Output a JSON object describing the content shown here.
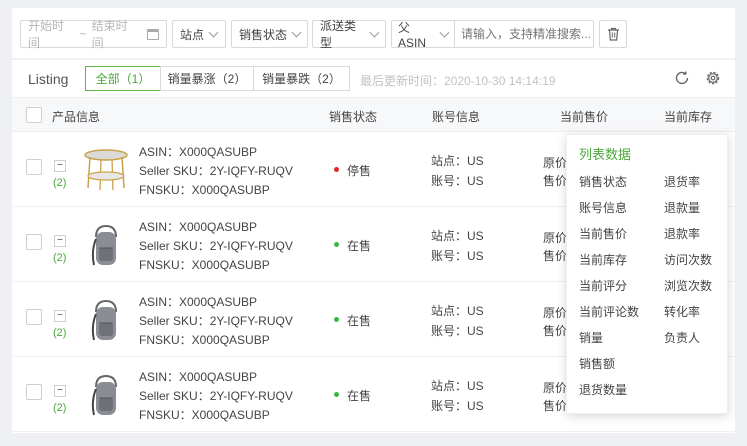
{
  "filters": {
    "start_placeholder": "开始时间",
    "range_sep": "~",
    "end_placeholder": "结束时间",
    "site_label": "站点",
    "sale_status_label": "销售状态",
    "ship_type_label": "派送类型",
    "asin_type_label": "父ASIN",
    "search_placeholder": "请输入，支持精准搜索..."
  },
  "toolbar": {
    "title": "Listing",
    "tabs": [
      {
        "label": "全部（1）"
      },
      {
        "label": "销量暴涨（2）"
      },
      {
        "label": "销量暴跌（2）"
      }
    ],
    "updated": "最后更新时间：2020-10-30 14:14:19",
    "icons": [
      "refresh-icon",
      "gear-icon"
    ]
  },
  "table": {
    "headers": {
      "product": "产品信息",
      "status": "销售状态",
      "account": "账号信息",
      "price": "当前售价",
      "stock": "当前库存"
    },
    "rows": [
      {
        "count": "(2)",
        "image": "round-table",
        "asin": "ASIN：X000QASUBP",
        "sku": "Seller SKU：2Y-IQFY-RUQV",
        "fnsku": "FNSKU：X000QASUBP",
        "status": "停售",
        "status_color": "#e0262c",
        "site": "站点：US",
        "account": "账号：US",
        "price_label1": "原价",
        "price_label2": "售价"
      },
      {
        "count": "(2)",
        "image": "backpack",
        "asin": "ASIN：X000QASUBP",
        "sku": "Seller SKU：2Y-IQFY-RUQV",
        "fnsku": "FNSKU：X000QASUBP",
        "status": "在售",
        "status_color": "#3bb54a",
        "site": "站点：US",
        "account": "账号：US",
        "price_label1": "原价",
        "price_label2": "售价"
      },
      {
        "count": "(2)",
        "image": "backpack",
        "asin": "ASIN：X000QASUBP",
        "sku": "Seller SKU：2Y-IQFY-RUQV",
        "fnsku": "FNSKU：X000QASUBP",
        "status": "在售",
        "status_color": "#3bb54a",
        "site": "站点：US",
        "account": "账号：US",
        "price_label1": "原价",
        "price_label2": "售价"
      },
      {
        "count": "(2)",
        "image": "backpack",
        "asin": "ASIN：X000QASUBP",
        "sku": "Seller SKU：2Y-IQFY-RUQV",
        "fnsku": "FNSKU：X000QASUBP",
        "status": "在售",
        "status_color": "#3bb54a",
        "site": "站点：US",
        "account": "账号：US",
        "price_label1": "原价",
        "price_label2": "售价"
      }
    ]
  },
  "column_menu": {
    "title": "列表数据",
    "left": [
      "销售状态",
      "账号信息",
      "当前售价",
      "当前库存",
      "当前评分",
      "当前评论数",
      "销量",
      "销售额",
      "退货数量"
    ],
    "right": [
      "退货率",
      "退款量",
      "退款率",
      "访问次数",
      "浏览次数",
      "转化率",
      "负责人"
    ]
  },
  "colors": {
    "accent": "#4aa83a",
    "stopped": "#e0262c",
    "selling": "#3bb54a"
  }
}
